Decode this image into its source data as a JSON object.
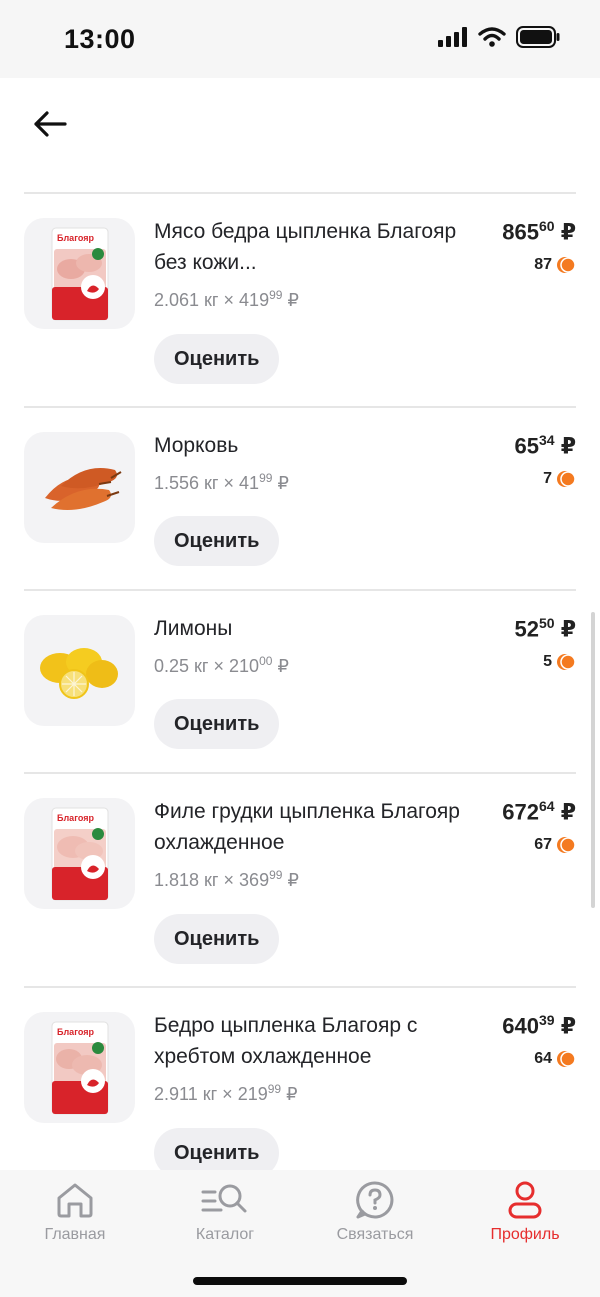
{
  "status": {
    "time": "13:00"
  },
  "items": [
    {
      "name": "Мясо бедра цыпленка Благояр без кожи...",
      "qty_weight": "2.061 кг",
      "qty_price_int": "419",
      "qty_price_dec": "99",
      "price_int": "865",
      "price_dec": "60",
      "points": "87",
      "rate_label": "Оценить",
      "image": "chicken-pack",
      "brand": "Благояр"
    },
    {
      "name": "Морковь",
      "qty_weight": "1.556 кг",
      "qty_price_int": "41",
      "qty_price_dec": "99",
      "price_int": "65",
      "price_dec": "34",
      "points": "7",
      "rate_label": "Оценить",
      "image": "carrots"
    },
    {
      "name": "Лимоны",
      "qty_weight": "0.25 кг",
      "qty_price_int": "210",
      "qty_price_dec": "00",
      "price_int": "52",
      "price_dec": "50",
      "points": "5",
      "rate_label": "Оценить",
      "image": "lemons"
    },
    {
      "name": "Филе грудки цыпленка Благояр охлажденное",
      "qty_weight": "1.818 кг",
      "qty_price_int": "369",
      "qty_price_dec": "99",
      "price_int": "672",
      "price_dec": "64",
      "points": "67",
      "rate_label": "Оценить",
      "image": "chicken-pack",
      "brand": "Благояр"
    },
    {
      "name": "Бедро цыпленка Благояр с хребтом охлажденное",
      "qty_weight": "2.911 кг",
      "qty_price_int": "219",
      "qty_price_dec": "99",
      "price_int": "640",
      "price_dec": "39",
      "points": "64",
      "rate_label": "Оценить",
      "image": "chicken-pack",
      "brand": "Благояр"
    }
  ],
  "currency": "₽",
  "times_sign": "×",
  "tabs": [
    {
      "label": "Главная",
      "icon": "home-icon"
    },
    {
      "label": "Каталог",
      "icon": "catalog-search-icon"
    },
    {
      "label": "Связаться",
      "icon": "help-chat-icon"
    },
    {
      "label": "Профиль",
      "icon": "profile-icon",
      "active": true
    }
  ],
  "colors": {
    "accent": "#e62e2e",
    "points_orange": "#f47a20",
    "inactive": "#9a9ba0"
  }
}
